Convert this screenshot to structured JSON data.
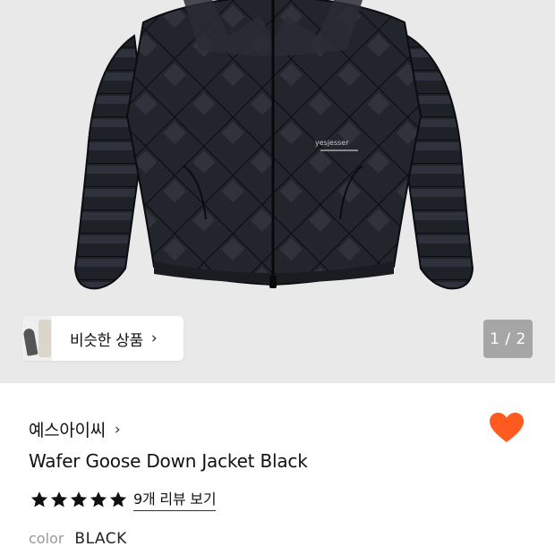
{
  "hero": {
    "image_alt": "Wafer Goose Down Jacket Black",
    "jacket_print": "yesjesser"
  },
  "similar": {
    "label": "비슷한 상품",
    "chevron": "›"
  },
  "pager": {
    "text": "1 / 2"
  },
  "product": {
    "brand": "예스아이씨",
    "brand_chevron": "›",
    "name": "Wafer Goose Down Jacket Black",
    "rating": 5,
    "review_link": "9개 리뷰 보기",
    "color_label": "color",
    "color_value": "BLACK",
    "liked": true
  },
  "colors": {
    "heart": "#ff5a1f",
    "pager_bg": "#a6a6a6",
    "hero_bg": "#e9e9e9"
  }
}
